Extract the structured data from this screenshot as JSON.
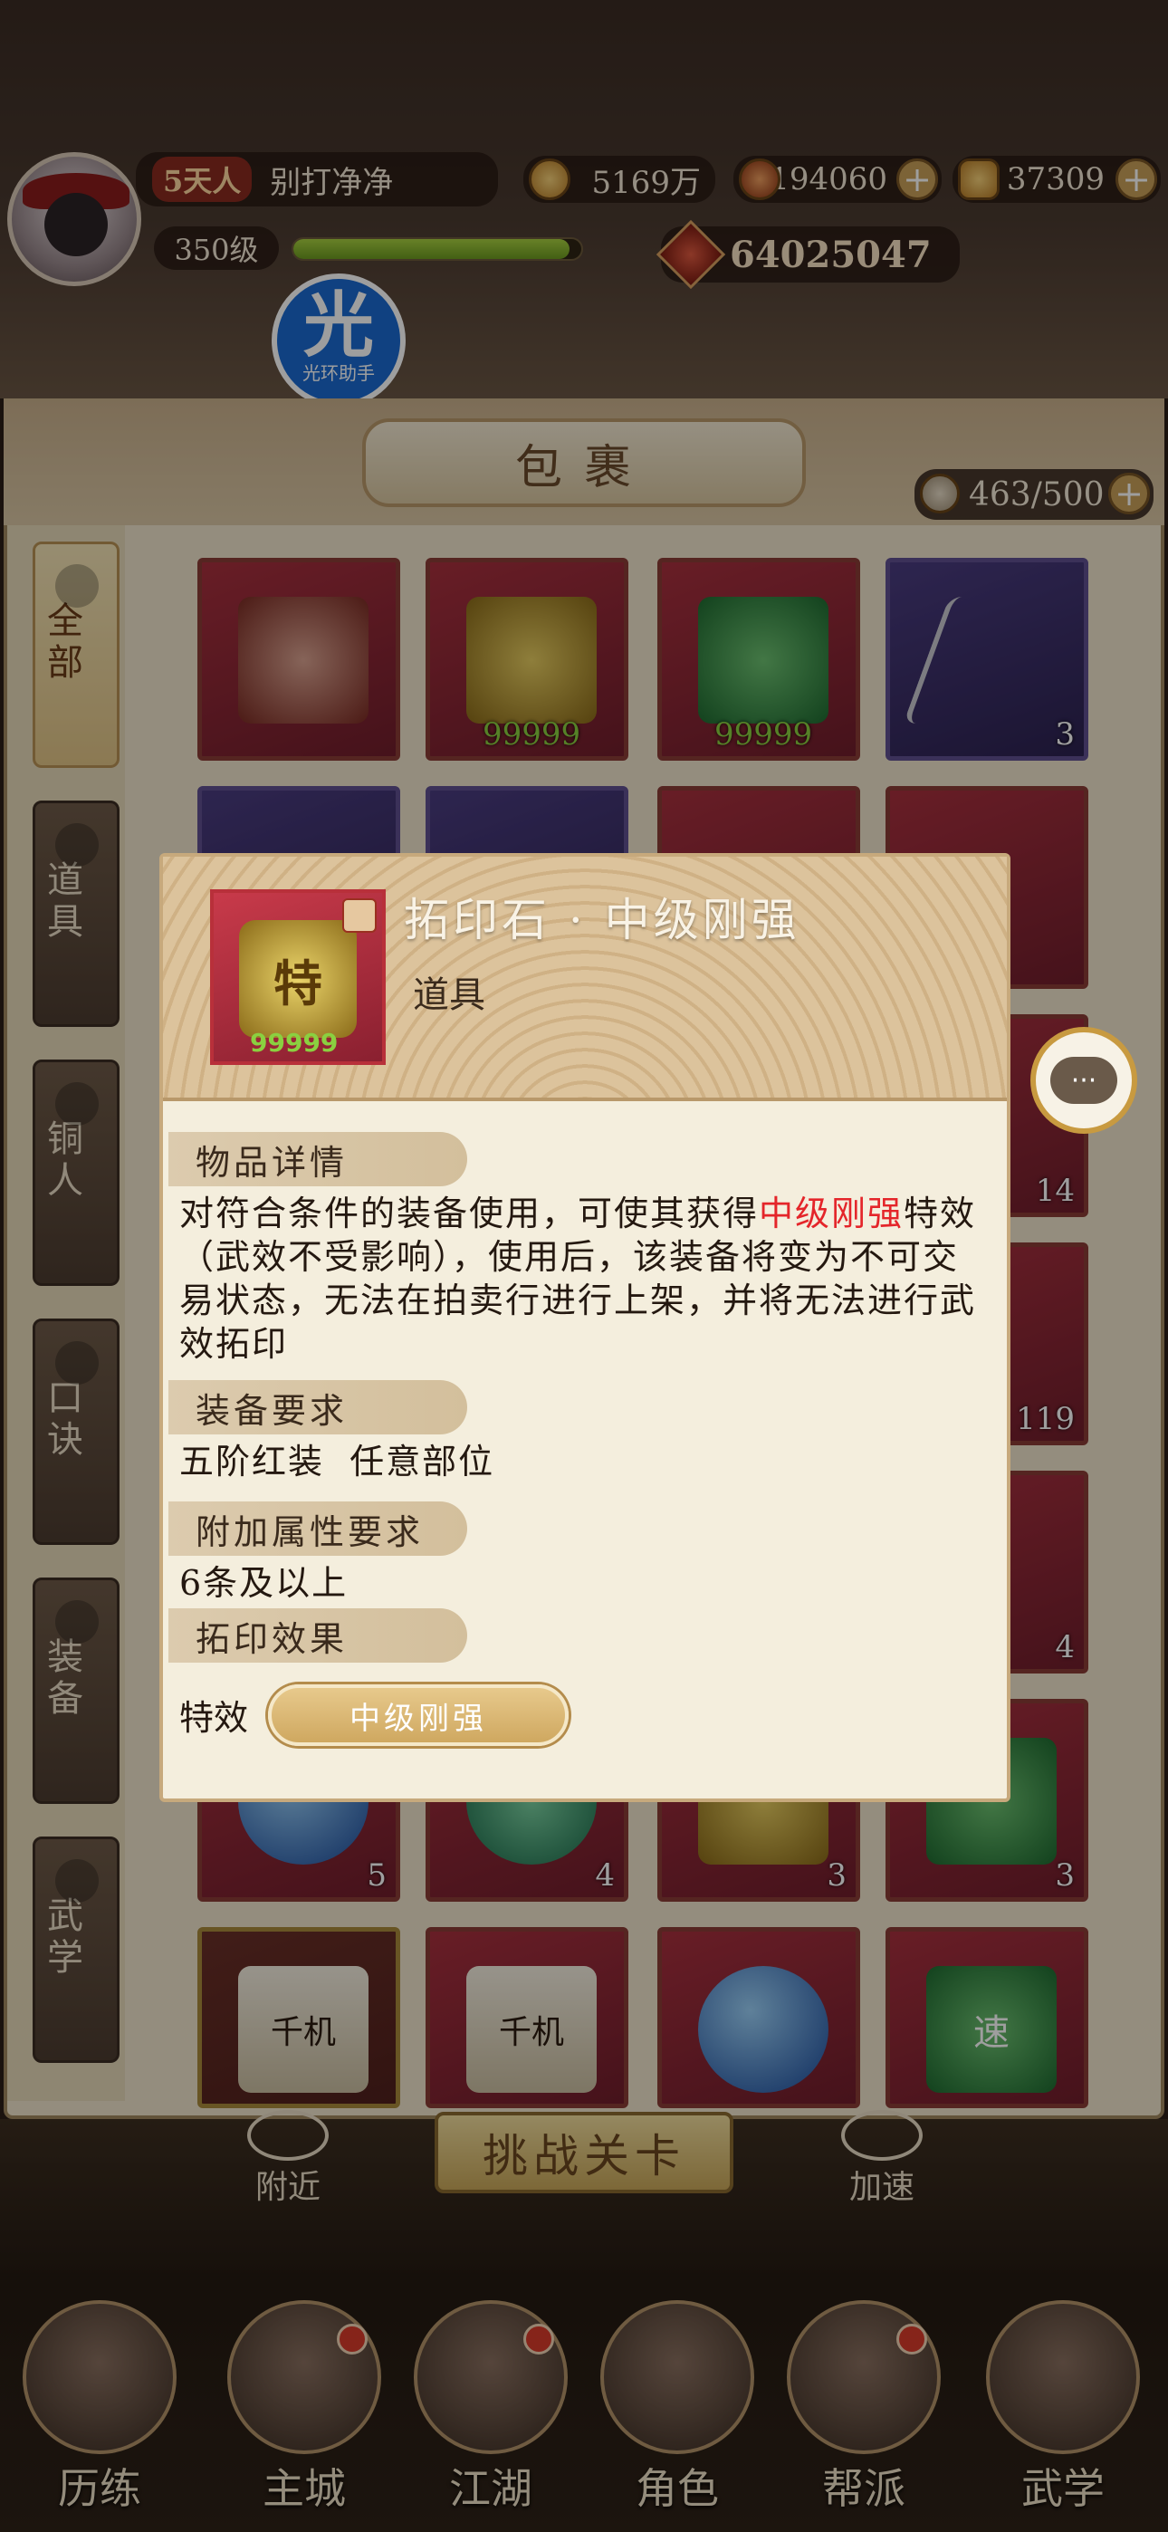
{
  "player": {
    "rank_badge": "5天人",
    "name": "别打净净",
    "level": "350级",
    "xp_fraction": 0.96,
    "power": "64025047"
  },
  "currencies": {
    "coins": "5169万",
    "silver": "194060",
    "gold": "37309"
  },
  "helper_badge": {
    "glyph": "光",
    "label": "光环助手"
  },
  "bag": {
    "title": "包裹",
    "capacity": "463/500",
    "tabs": [
      "全部",
      "道具",
      "铜人",
      "口诀",
      "装备",
      "武学"
    ],
    "active_tab": "全部",
    "item_counts": [
      "99999",
      "99999",
      "3",
      "14",
      "119",
      "4",
      "5",
      "4",
      "3",
      "3"
    ],
    "scroll_labels": [
      "千机",
      "千机",
      "速"
    ]
  },
  "popup": {
    "title": "拓印石 · 中级刚强",
    "type": "道具",
    "icon_glyph": "特",
    "icon_count": "99999",
    "section1_title": "物品详情",
    "desc_prefix": "对符合条件的装备使用，可使其获得",
    "desc_highlight": "中级刚强",
    "desc_rest": "特效（武效不受影响），使用后，该装备将变为不可交易状态，无法在拍卖行进行上架，并将无法进行武效拓印",
    "section2_title": "装备要求",
    "equip_req": "五阶红装  任意部位",
    "section3_title": "附加属性要求",
    "attr_req": "6条及以上",
    "section4_title": "拓印效果",
    "effect_label": "特效",
    "effect_button": "中级刚强"
  },
  "bottom": {
    "challenge": "挑战关卡",
    "nearby": "附近",
    "speedup": "加速",
    "nav": [
      "历练",
      "主城",
      "江湖",
      "角色",
      "帮派",
      "武学"
    ]
  },
  "colors": {
    "highlight": "#e4252a",
    "accent": "#c89a40",
    "panel": "#f4eedd"
  }
}
